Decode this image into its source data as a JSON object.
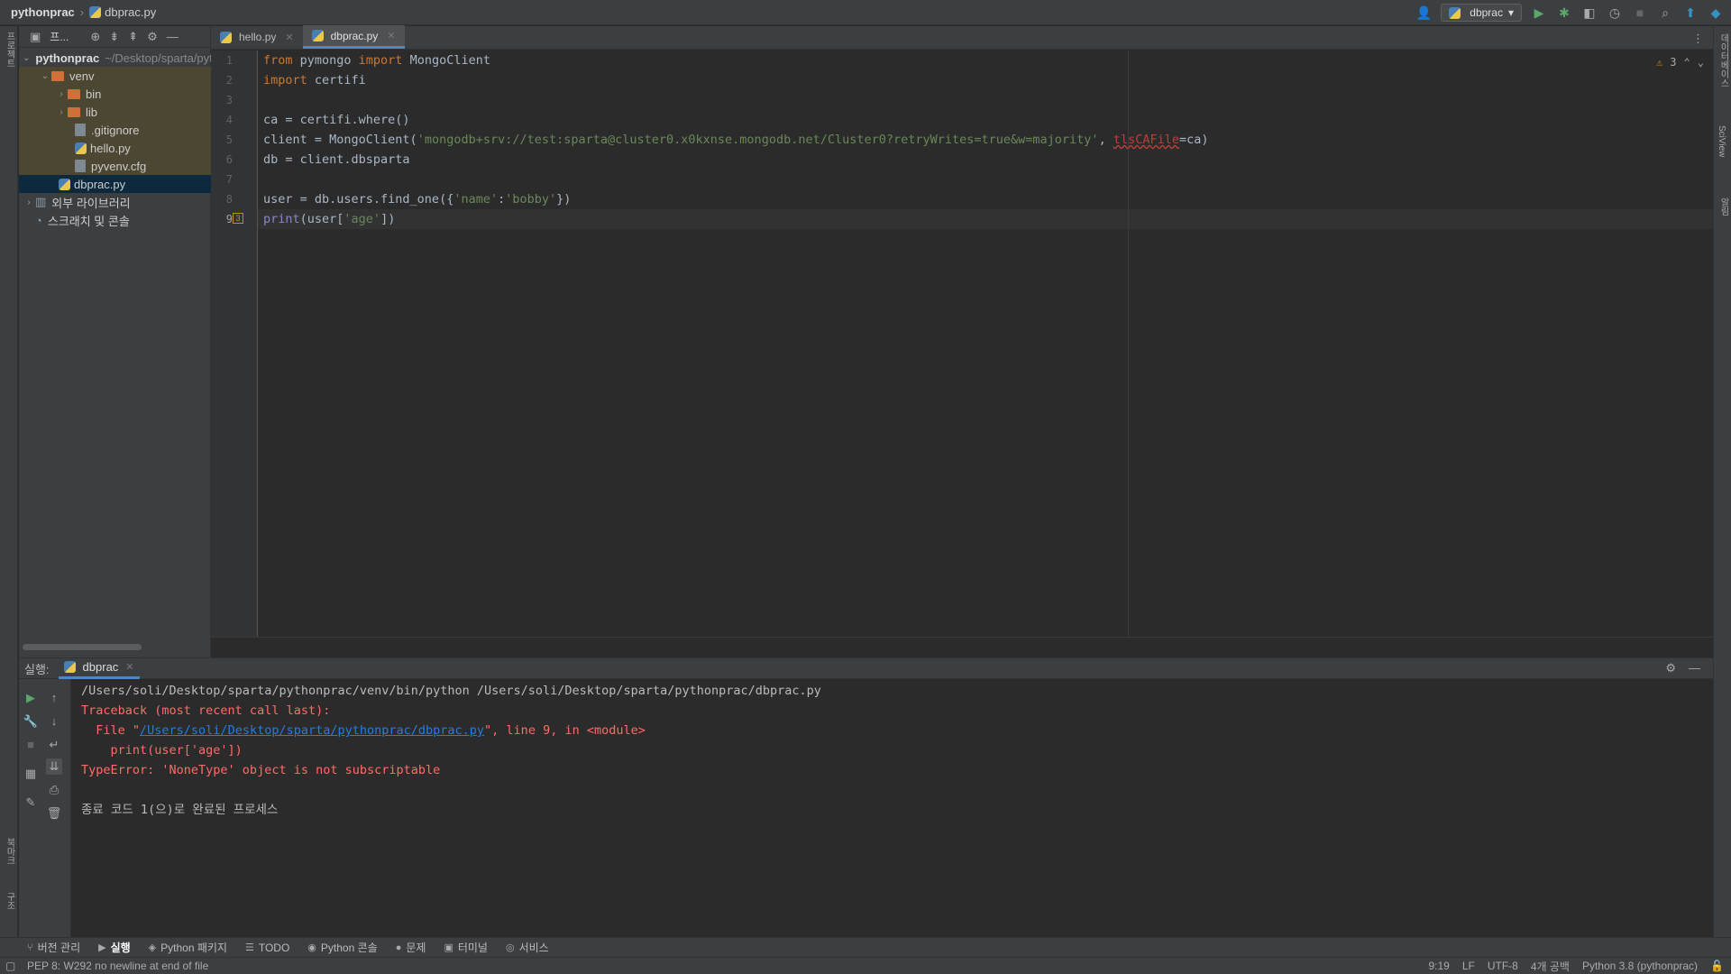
{
  "nav": {
    "project": "pythonprac",
    "file": "dbprac.py",
    "run_config": "dbprac"
  },
  "left_strip": {
    "project_label": "프로젝트",
    "bookmarks_label": "북마크",
    "structure_label": "구조"
  },
  "right_strip": {
    "database_label": "데이터베이스",
    "sciview_label": "SciView",
    "notifications_label": "알림"
  },
  "project_panel": {
    "title": "프...",
    "tree": [
      {
        "label": "pythonprac",
        "suffix": "~/Desktop/sparta/pythonprac"
      },
      {
        "label": "venv"
      },
      {
        "label": "bin"
      },
      {
        "label": "lib"
      },
      {
        "label": ".gitignore"
      },
      {
        "label": "hello.py"
      },
      {
        "label": "pyvenv.cfg"
      },
      {
        "label": "dbprac.py"
      },
      {
        "label": "외부 라이브러리"
      },
      {
        "label": "스크래치 및 콘솔"
      }
    ]
  },
  "tabs": [
    {
      "label": "hello.py"
    },
    {
      "label": "dbprac.py"
    }
  ],
  "editor": {
    "line_numbers": [
      "1",
      "2",
      "3",
      "4",
      "5",
      "6",
      "7",
      "8",
      "9"
    ],
    "lines": [
      {
        "kw": "from",
        "t1": " pymongo ",
        "kw2": "import",
        "t2": " MongoClient"
      },
      {
        "kw": "import",
        "t1": " certifi"
      },
      {},
      {
        "t1": "ca = certifi.where()"
      },
      {
        "t1": "client = MongoClient(",
        "s1": "'mongodb+srv://test:sparta@cluster0.x0kxnse.mongodb.net/Cluster0?retryWrites=true&w=majority'",
        "t2": ", ",
        "e1": "tlsCAFile",
        "t3": "=ca)"
      },
      {
        "t1": "db = client.dbsparta"
      },
      {},
      {
        "t1": "user = db.users.find_one({",
        "s1": "'name'",
        "t2": ":",
        "s2": "'bobby'",
        "t3": "})"
      },
      {
        "f1": "print",
        "t1": "(user[",
        "s1": "'age'",
        "t2": "])"
      }
    ],
    "warnings_count": "3"
  },
  "run_panel": {
    "label": "실행:",
    "tab": "dbprac",
    "console": {
      "cmd": "/Users/soli/Desktop/sparta/pythonprac/venv/bin/python /Users/soli/Desktop/sparta/pythonprac/dbprac.py",
      "tb_head": "Traceback (most recent call last):",
      "file_pre": "  File \"",
      "file_link": "/Users/soli/Desktop/sparta/pythonprac/dbprac.py",
      "file_post": "\", line 9, in <module>",
      "tb_code": "    print(user['age'])",
      "tb_err": "TypeError: 'NoneType' object is not subscriptable",
      "exit": "종료 코드 1(으)로 완료된 프로세스"
    }
  },
  "bottom_tabs": [
    {
      "label": "버전 관리",
      "icon": "branch-icon"
    },
    {
      "label": "실행",
      "icon": "play-icon"
    },
    {
      "label": "Python 패키지",
      "icon": "layers-icon"
    },
    {
      "label": "TODO",
      "icon": "list-icon"
    },
    {
      "label": "Python 콘솔",
      "icon": "python-icon"
    },
    {
      "label": "문제",
      "icon": "info-icon"
    },
    {
      "label": "터미널",
      "icon": "terminal-icon"
    },
    {
      "label": "서비스",
      "icon": "services-icon"
    }
  ],
  "status": {
    "message": "PEP 8: W292 no newline at end of file",
    "position": "9:19",
    "line_sep": "LF",
    "encoding": "UTF-8",
    "indent": "4개 공백",
    "interpreter": "Python 3.8 (pythonprac)"
  },
  "colors": {
    "accent": "#4a88c7",
    "error": "#ff6b68",
    "keyword": "#cc7832",
    "string": "#6a8759",
    "link": "#287bde"
  }
}
